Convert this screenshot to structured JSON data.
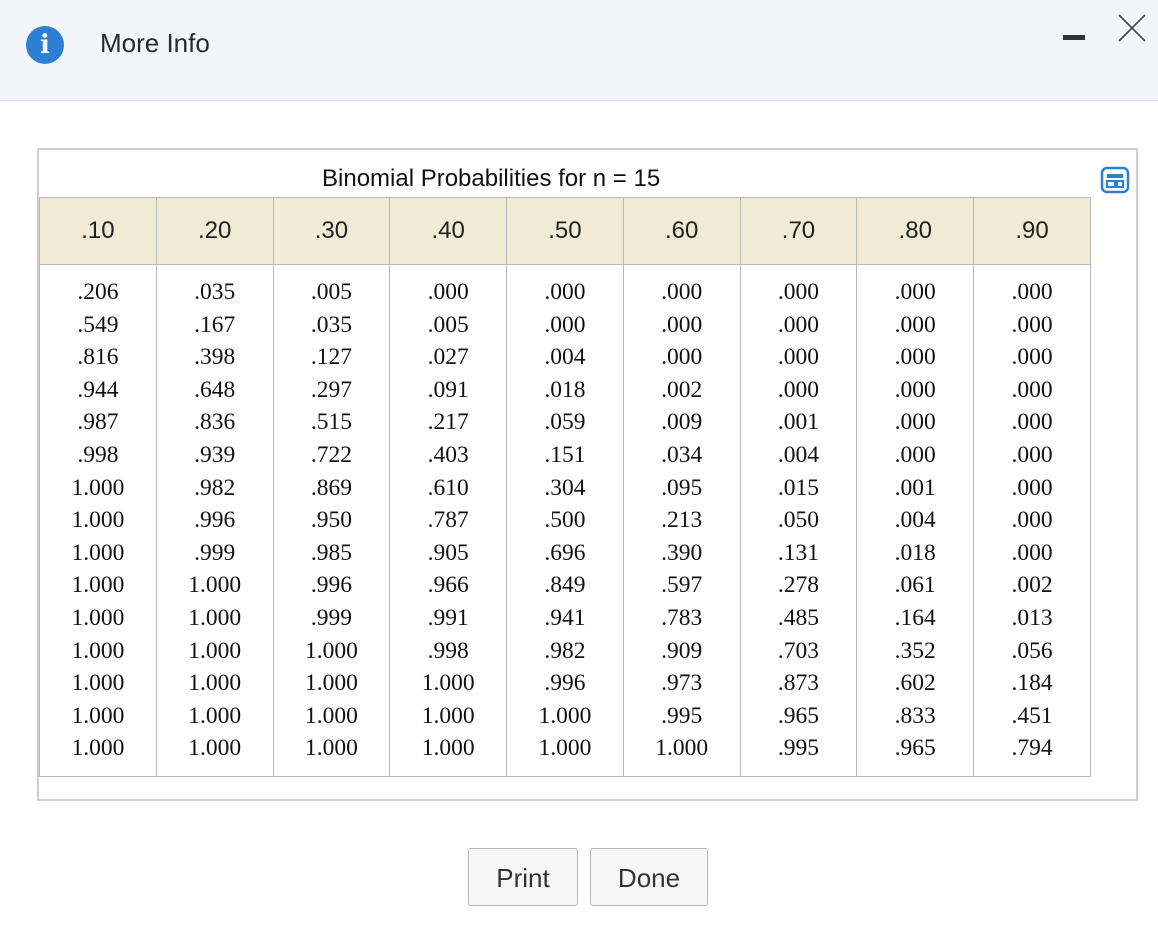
{
  "dialog": {
    "title": "More Info",
    "info_icon": "info-icon",
    "info_icon_glyph": "i",
    "minimize_icon": "minimize-icon",
    "close_icon": "close-icon"
  },
  "table": {
    "caption": "Binomial Probabilities for n = 15",
    "copy_icon": "copy-icon",
    "headers": [
      ".10",
      ".20",
      ".30",
      ".40",
      ".50",
      ".60",
      ".70",
      ".80",
      ".90"
    ],
    "columns": [
      [
        ".206",
        ".549",
        ".816",
        ".944",
        ".987",
        ".998",
        "1.000",
        "1.000",
        "1.000",
        "1.000",
        "1.000",
        "1.000",
        "1.000",
        "1.000",
        "1.000"
      ],
      [
        ".035",
        ".167",
        ".398",
        ".648",
        ".836",
        ".939",
        ".982",
        ".996",
        ".999",
        "1.000",
        "1.000",
        "1.000",
        "1.000",
        "1.000",
        "1.000"
      ],
      [
        ".005",
        ".035",
        ".127",
        ".297",
        ".515",
        ".722",
        ".869",
        ".950",
        ".985",
        ".996",
        ".999",
        "1.000",
        "1.000",
        "1.000",
        "1.000"
      ],
      [
        ".000",
        ".005",
        ".027",
        ".091",
        ".217",
        ".403",
        ".610",
        ".787",
        ".905",
        ".966",
        ".991",
        ".998",
        "1.000",
        "1.000",
        "1.000"
      ],
      [
        ".000",
        ".000",
        ".004",
        ".018",
        ".059",
        ".151",
        ".304",
        ".500",
        ".696",
        ".849",
        ".941",
        ".982",
        ".996",
        "1.000",
        "1.000"
      ],
      [
        ".000",
        ".000",
        ".000",
        ".002",
        ".009",
        ".034",
        ".095",
        ".213",
        ".390",
        ".597",
        ".783",
        ".909",
        ".973",
        ".995",
        "1.000"
      ],
      [
        ".000",
        ".000",
        ".000",
        ".000",
        ".001",
        ".004",
        ".015",
        ".050",
        ".131",
        ".278",
        ".485",
        ".703",
        ".873",
        ".965",
        ".995"
      ],
      [
        ".000",
        ".000",
        ".000",
        ".000",
        ".000",
        ".000",
        ".001",
        ".004",
        ".018",
        ".061",
        ".164",
        ".352",
        ".602",
        ".833",
        ".965"
      ],
      [
        ".000",
        ".000",
        ".000",
        ".000",
        ".000",
        ".000",
        ".000",
        ".000",
        ".000",
        ".002",
        ".013",
        ".056",
        ".184",
        ".451",
        ".794"
      ]
    ]
  },
  "buttons": {
    "print_label": "Print",
    "done_label": "Done"
  },
  "colors": {
    "accent": "#2d7fd4",
    "header_bg": "#f2f5fa",
    "table_header_bg": "#f1ead5"
  }
}
